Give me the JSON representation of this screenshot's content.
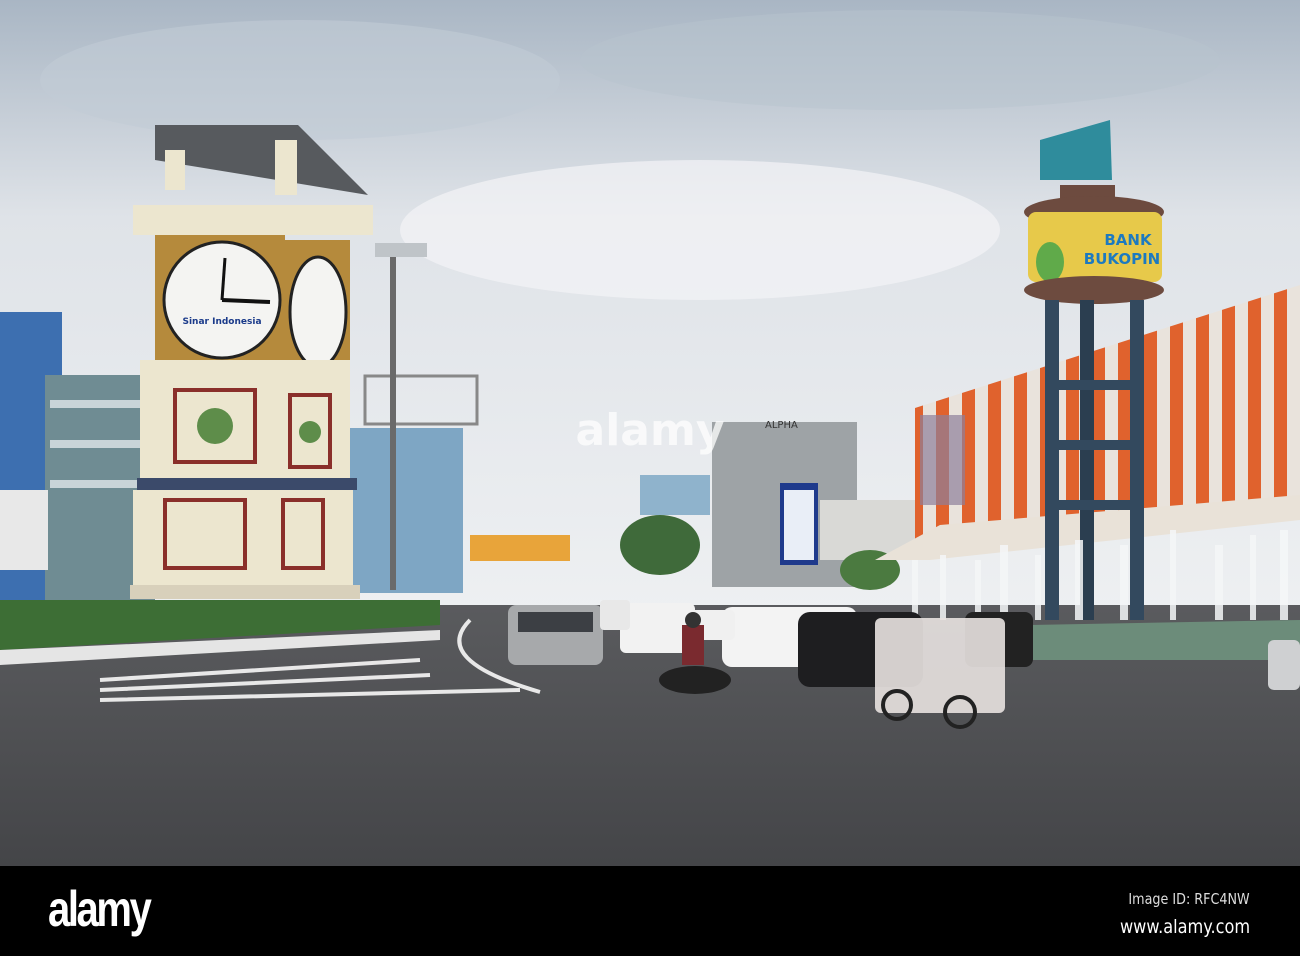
{
  "photo": {
    "clock_tower_brand": "Sinar Indonesia",
    "bank_sign_line1": "BANK",
    "bank_sign_line2": "BUKOPIN",
    "hotel_sign": "ALPHA",
    "watermark": "alamy"
  },
  "footer": {
    "logo": "alamy",
    "image_id": "Image ID: RFC4NW",
    "website": "www.alamy.com"
  }
}
